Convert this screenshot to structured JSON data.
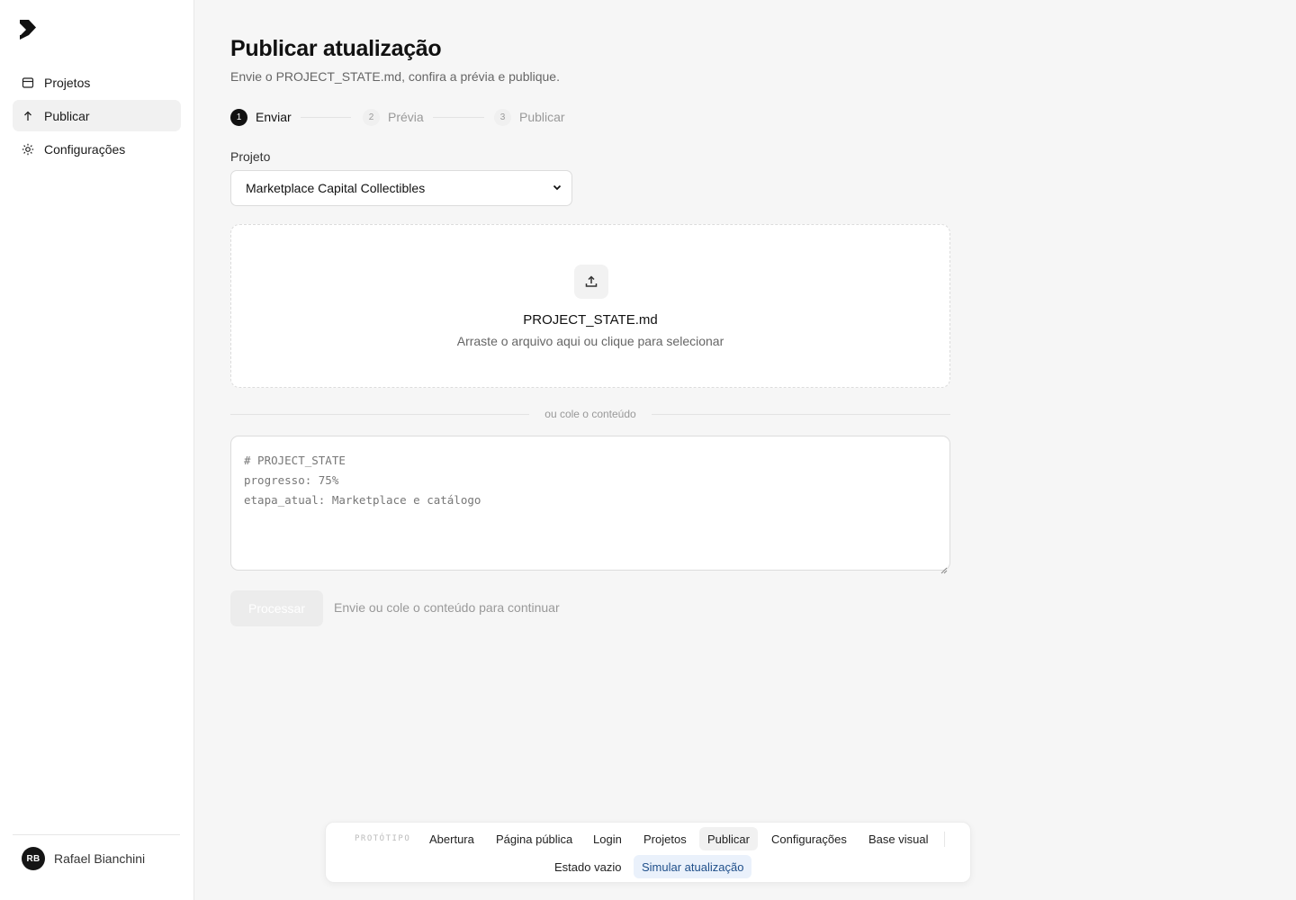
{
  "sidebar": {
    "items": [
      {
        "label": "Projetos",
        "icon": "folder-icon"
      },
      {
        "label": "Publicar",
        "icon": "arrow-up-icon",
        "active": true
      },
      {
        "label": "Configurações",
        "icon": "gear-icon"
      }
    ],
    "user": {
      "initials": "RB",
      "name": "Rafael Bianchini"
    }
  },
  "page": {
    "title": "Publicar atualização",
    "subtitle": "Envie o PROJECT_STATE.md, confira a prévia e publique."
  },
  "stepper": [
    {
      "num": "1",
      "label": "Enviar",
      "active": true
    },
    {
      "num": "2",
      "label": "Prévia",
      "active": false
    },
    {
      "num": "3",
      "label": "Publicar",
      "active": false
    }
  ],
  "form": {
    "project_label": "Projeto",
    "project_value": "Marketplace Capital Collectibles",
    "dropzone_title": "PROJECT_STATE.md",
    "dropzone_hint": "Arraste o arquivo aqui ou clique para selecionar",
    "divider_text": "ou cole o conteúdo",
    "textarea_lines": [
      "# PROJECT_STATE",
      "progresso: 75%",
      "etapa_atual: Marketplace e catálogo"
    ],
    "process_label": "Processar",
    "process_hint": "Envie ou cole o conteúdo para continuar"
  },
  "proto_bar": {
    "tag": "PROTÓTIPO",
    "links": [
      "Abertura",
      "Página pública",
      "Login",
      "Projetos",
      "Publicar",
      "Configurações",
      "Base visual",
      "Estado vazio",
      "Simular atualização"
    ],
    "active": "Publicar",
    "highlight": "Simular atualização"
  },
  "colors": {
    "accent": "#111111",
    "highlight_bg": "#eaf1fb",
    "highlight_text": "#1f4f8a"
  }
}
